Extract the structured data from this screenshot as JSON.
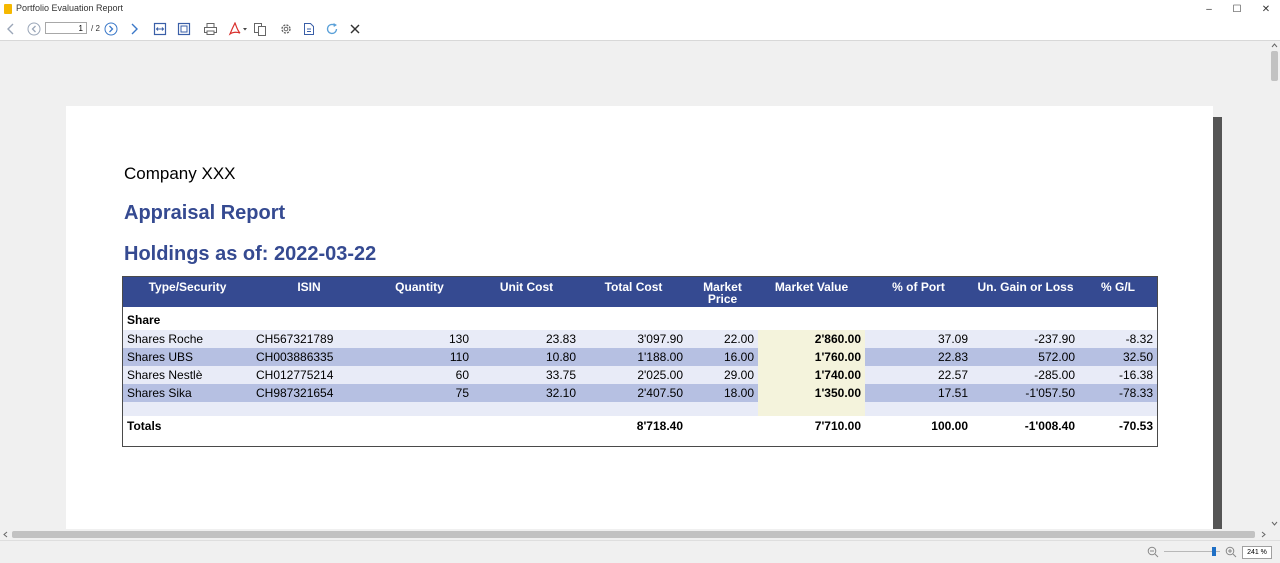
{
  "window": {
    "title": "Portfolio Evaluation Report"
  },
  "toolbar": {
    "page_value": "1",
    "page_total": "/ 2"
  },
  "report": {
    "company": "Company XXX",
    "title": "Appraisal Report",
    "subtitle": "Holdings as of: 2022-03-22",
    "columns": [
      "Type/Security",
      "ISIN",
      "Quantity",
      "Unit Cost",
      "Total Cost",
      "Market\nPrice",
      "Market Value",
      "% of Port",
      "Un. Gain or Loss",
      "% G/L"
    ],
    "section": "Share",
    "rows": [
      {
        "security": "Shares Roche",
        "isin": "CH567321789",
        "quantity": "130",
        "unit_cost": "23.83",
        "total_cost": "3'097.90",
        "market_price": "22.00",
        "market_value": "2'860.00",
        "pct_port": "37.09",
        "gain_loss": "-237.90",
        "pct_gl": "-8.32"
      },
      {
        "security": "Shares UBS",
        "isin": "CH003886335",
        "quantity": "110",
        "unit_cost": "10.80",
        "total_cost": "1'188.00",
        "market_price": "16.00",
        "market_value": "1'760.00",
        "pct_port": "22.83",
        "gain_loss": "572.00",
        "pct_gl": "32.50"
      },
      {
        "security": "Shares Nestlè",
        "isin": "CH012775214",
        "quantity": "60",
        "unit_cost": "33.75",
        "total_cost": "2'025.00",
        "market_price": "29.00",
        "market_value": "1'740.00",
        "pct_port": "22.57",
        "gain_loss": "-285.00",
        "pct_gl": "-16.38"
      },
      {
        "security": "Shares Sika",
        "isin": "CH987321654",
        "quantity": "75",
        "unit_cost": "32.10",
        "total_cost": "2'407.50",
        "market_price": "18.00",
        "market_value": "1'350.00",
        "pct_port": "17.51",
        "gain_loss": "-1'057.50",
        "pct_gl": "-78.33"
      }
    ],
    "totals": {
      "label": "Totals",
      "total_cost": "8'718.40",
      "market_value": "7'710.00",
      "pct_port": "100.00",
      "gain_loss": "-1'008.40",
      "pct_gl": "-70.53"
    }
  },
  "status": {
    "zoom": "241 %"
  },
  "colors": {
    "accent": "#354a91",
    "row_light": "#e8ebf7",
    "row_dark": "#b6c0e2",
    "market_value_bg": "#f4f3dc"
  }
}
